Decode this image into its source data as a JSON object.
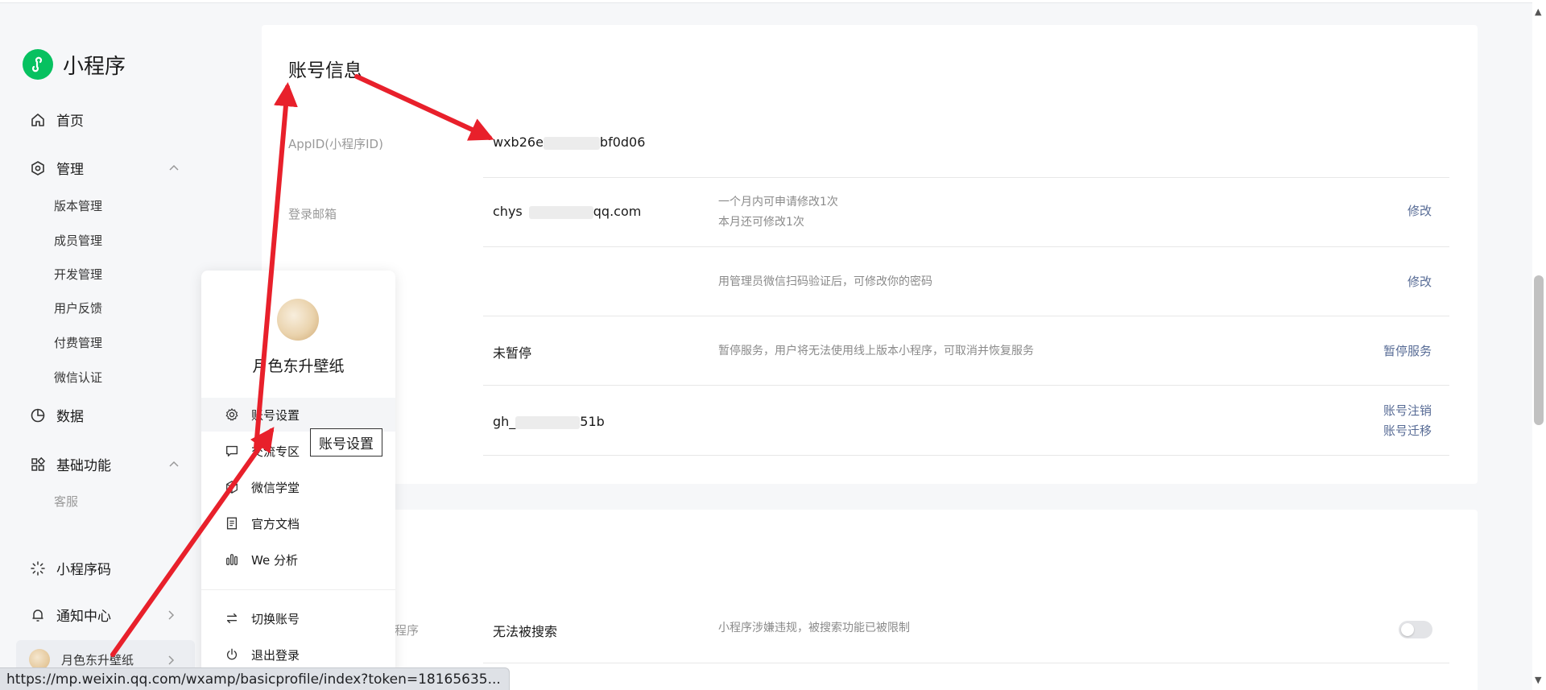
{
  "app": {
    "title": "小程序"
  },
  "sidebar": {
    "home": "首页",
    "manage": {
      "label": "管理",
      "items": [
        "版本管理",
        "成员管理",
        "开发管理",
        "用户反馈",
        "付费管理",
        "微信认证"
      ]
    },
    "data": "数据",
    "basic": {
      "label": "基础功能",
      "items": [
        "客服"
      ]
    },
    "qrcode": "小程序码",
    "notify": "通知中心",
    "user": "月色东升壁纸"
  },
  "account_section": {
    "title": "账号信息",
    "appid_label": "AppID(小程序ID)",
    "appid_start": "wxb26e",
    "appid_end": "bf0d06",
    "email_label": "登录邮箱",
    "email_start": "chys",
    "email_end": "qq.com",
    "email_desc_1": "一个月内可申请修改1次",
    "email_desc_2": "本月还可修改1次",
    "email_action": "修改",
    "password_desc": "用管理员微信扫码验证后，可修改你的密码",
    "password_action": "修改",
    "service_value": "未暂停",
    "service_desc": "暂停服务，用户将无法使用线上版本小程序，可取消并恢复服务",
    "service_action": "暂停服务",
    "orig_id_start": "gh_",
    "orig_id_end": "51b",
    "cancel_action": "账号注销",
    "migrate_action": "账号迁移"
  },
  "search_section": {
    "label_tail": "程序",
    "value": "无法被搜索",
    "desc": "小程序涉嫌违规，被搜索功能已被限制",
    "toggle_on": false
  },
  "popup": {
    "name": "月色东升壁纸",
    "items": [
      "账号设置",
      "交流专区",
      "微信学堂",
      "官方文档",
      "We 分析",
      "切换账号",
      "退出登录"
    ]
  },
  "tooltip": "账号设置",
  "status_url": "https://mp.weixin.qq.com/wxamp/basicprofile/index?token=18165635...",
  "colors": {
    "brand": "#07c160",
    "link": "#576b95",
    "annotation": "#e8202b"
  }
}
